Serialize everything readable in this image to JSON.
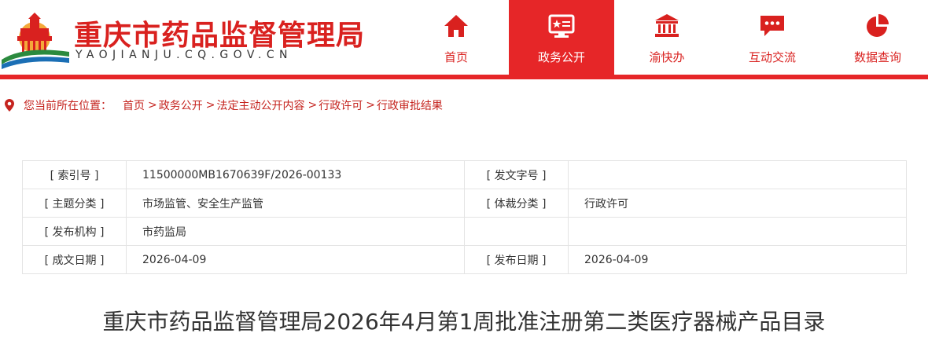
{
  "header": {
    "site_title": "重庆市药品监督管理局",
    "site_domain": "YAOJIANJU.CQ.GOV.CN",
    "brand_color": "#e62628"
  },
  "nav": {
    "items": [
      {
        "label": "首页",
        "icon": "home-icon",
        "active": false
      },
      {
        "label": "政务公开",
        "icon": "government-info-icon",
        "active": true
      },
      {
        "label": "渝快办",
        "icon": "government-building-icon",
        "active": false
      },
      {
        "label": "互动交流",
        "icon": "chat-icon",
        "active": false
      },
      {
        "label": "数据查询",
        "icon": "pie-chart-icon",
        "active": false
      }
    ]
  },
  "breadcrumb": {
    "label": "您当前所在位置：",
    "items": [
      "首页",
      "政务公开",
      "法定主动公开内容",
      "行政许可",
      "行政审批结果"
    ],
    "separator": ">"
  },
  "meta": {
    "rows": [
      {
        "k1": "[ 索引号 ]",
        "v1": "11500000MB1670639F/2026-00133",
        "k2": "[ 发文字号 ]",
        "v2": ""
      },
      {
        "k1": "[ 主题分类 ]",
        "v1": "市场监管、安全生产监管",
        "k2": "[ 体裁分类 ]",
        "v2": "行政许可"
      },
      {
        "k1": "[ 发布机构 ]",
        "v1": "市药监局",
        "k2": "",
        "v2": ""
      },
      {
        "k1": "[ 成文日期 ]",
        "v1": "2026-04-09",
        "k2": "[ 发布日期 ]",
        "v2": "2026-04-09"
      }
    ]
  },
  "document": {
    "title": "重庆市药品监督管理局2026年4月第1周批准注册第二类医疗器械产品目录"
  }
}
